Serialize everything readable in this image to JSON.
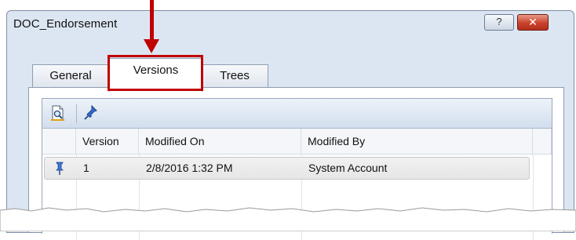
{
  "window": {
    "title": "DOC_Endorsement",
    "help_label": "?",
    "close_label": "✕"
  },
  "tabs": [
    {
      "label": "General",
      "active": false
    },
    {
      "label": "Versions",
      "active": true
    },
    {
      "label": "Trees",
      "active": false
    }
  ],
  "toolbar": {
    "buttons": [
      {
        "icon": "view-document-icon"
      },
      {
        "icon": "pin-icon"
      }
    ]
  },
  "grid": {
    "columns": [
      "",
      "Version",
      "Modified On",
      "Modified By"
    ],
    "rows": [
      {
        "pinned": true,
        "version": "1",
        "modified_on": "2/8/2016 1:32 PM",
        "modified_by": "System Account"
      }
    ]
  },
  "colors": {
    "annotation": "#c00000",
    "window_chrome": "#dce6f2",
    "close_button": "#c9412c"
  }
}
